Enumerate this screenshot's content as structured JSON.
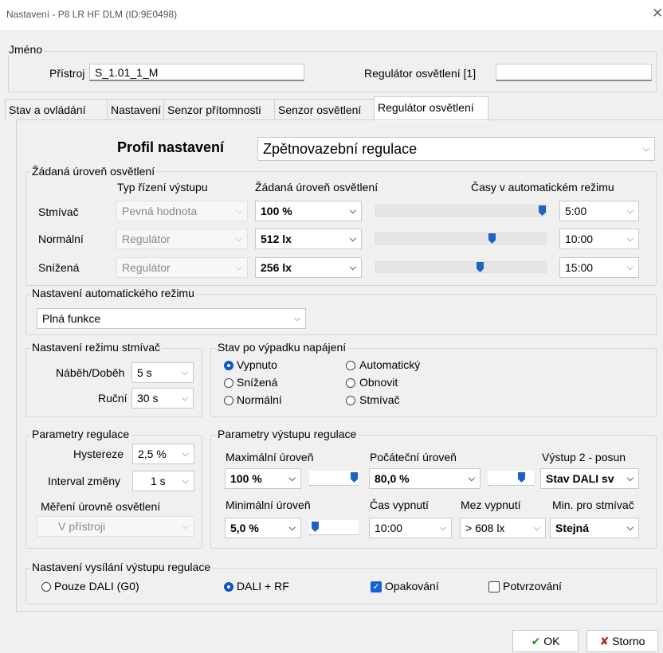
{
  "window": {
    "title": "Nastavení - P8 LR HF DLM (ID:9E0498)"
  },
  "name_group": {
    "label": "Jméno",
    "device_label": "Přístroj",
    "device_value": "S_1.01_1_M",
    "regulator_label": "Regulátor osvětlení [1]",
    "regulator_value": ""
  },
  "tabs": [
    "Stav a ovládání",
    "Nastavení",
    "Senzor přítomnosti",
    "Senzor osvětlení",
    "Regulátor osvětlení"
  ],
  "active_tab": "Regulátor osvětlení",
  "profile": {
    "label": "Profil nastavení",
    "value": "Zpětnovazební regulace"
  },
  "levels": {
    "group_label": "Žádaná úroveň osvětlení",
    "col_output": "Typ řízení výstupu",
    "col_level": "Žádaná úroveň osvětlení",
    "col_times": "Časy v automatickém režimu",
    "rows": [
      {
        "name": "Stmívač",
        "output": "Pevná hodnota",
        "level": "100 %",
        "slider": 1.0,
        "time": "5:00"
      },
      {
        "name": "Normální",
        "output": "Regulátor",
        "level": "512 lx",
        "slider": 0.71,
        "time": "10:00"
      },
      {
        "name": "Snížená",
        "output": "Regulátor",
        "level": "256 lx",
        "slider": 0.6,
        "time": "15:00"
      }
    ]
  },
  "auto_mode": {
    "label": "Nastavení automatického režimu",
    "value": "Plná funkce"
  },
  "dimmer_mode": {
    "label": "Nastavení režimu stmívač",
    "ramp_label": "Náběh/Doběh",
    "ramp_value": "5 s",
    "manual_label": "Ruční",
    "manual_value": "30 s"
  },
  "power_fail": {
    "label": "Stav po výpadku napájení",
    "options": [
      "Vypnuto",
      "Automatický",
      "Snížená",
      "Obnovit",
      "Normální",
      "Stmívač"
    ],
    "selected": "Vypnuto"
  },
  "reg_params": {
    "label": "Parametry regulace",
    "hyst_label": "Hystereze",
    "hyst_value": "2,5 %",
    "interval_label": "Interval změny",
    "interval_value": "1 s",
    "meas_label": "Měření úrovně osvětlení",
    "meas_value": "V přístroji"
  },
  "out_params": {
    "label": "Parametry výstupu regulace",
    "max_label": "Maximální úroveň",
    "max_value": "100 %",
    "max_slider": 1.0,
    "init_label": "Počáteční úroveň",
    "init_value": "80,0 %",
    "init_slider": 0.8,
    "out2_label": "Výstup 2 - posun",
    "out2_value": "Stav DALI sv",
    "min_label": "Minimální úroveň",
    "min_value": "5,0 %",
    "min_slider": 0.05,
    "off_time_label": "Čas vypnutí",
    "off_time_value": "10:00",
    "off_limit_label": "Mez vypnutí",
    "off_limit_value": "> 608 lx",
    "min_dim_label": "Min. pro stmívač",
    "min_dim_value": "Stejná"
  },
  "broadcast": {
    "label": "Nastavení vysílání výstupu regulace",
    "opt_dali": "Pouze DALI (G0)",
    "opt_dali_rf": "DALI + RF",
    "selected": "DALI + RF",
    "repeat_label": "Opakování",
    "repeat_checked": true,
    "confirm_label": "Potvrzování",
    "confirm_checked": false
  },
  "buttons": {
    "ok": "OK",
    "cancel": "Storno"
  },
  "colors": {
    "accent": "#1560d6",
    "ok_check": "#2a8a2a",
    "cancel_x": "#c0161c"
  }
}
